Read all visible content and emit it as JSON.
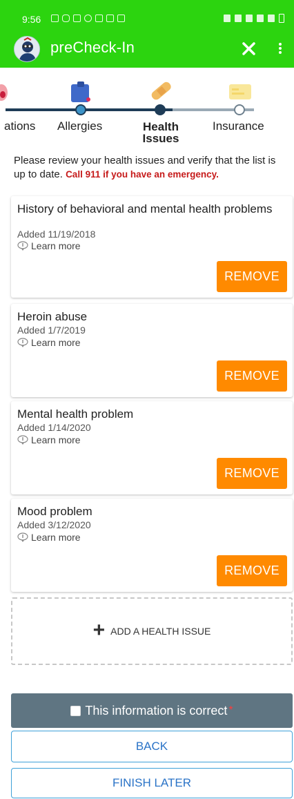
{
  "status_bar": {
    "time": "9:56"
  },
  "app_bar": {
    "title": "preCheck-In"
  },
  "stepper": {
    "steps": [
      {
        "label": "ations"
      },
      {
        "label": "Allergies"
      },
      {
        "label": "Health\nIssues"
      },
      {
        "label": "Insurance"
      }
    ]
  },
  "intro": {
    "text": "Please review your health issues and verify that the list is up to date. ",
    "warning": "Call 911 if you have an emergency."
  },
  "issues": [
    {
      "title": "History of behavioral and mental health problems",
      "date": "Added 11/19/2018",
      "learn": "Learn more",
      "remove": "REMOVE"
    },
    {
      "title": "Heroin abuse",
      "date": "Added 1/7/2019",
      "learn": "Learn more",
      "remove": "REMOVE"
    },
    {
      "title": "Mental health problem",
      "date": "Added 1/14/2020",
      "learn": "Learn more",
      "remove": "REMOVE"
    },
    {
      "title": "Mood problem",
      "date": "Added 3/12/2020",
      "learn": "Learn more",
      "remove": "REMOVE"
    }
  ],
  "add_issue": {
    "label": "ADD A HEALTH ISSUE"
  },
  "confirm": {
    "label": "This information is correct",
    "required_mark": "*"
  },
  "buttons": {
    "back": "BACK",
    "finish_later": "FINISH LATER"
  },
  "colors": {
    "app_bar": "#2cd40f",
    "remove": "#ff8a00",
    "confirm_bar": "#5f7582",
    "outline": "#3da0d8",
    "warning": "#c61a1a"
  }
}
